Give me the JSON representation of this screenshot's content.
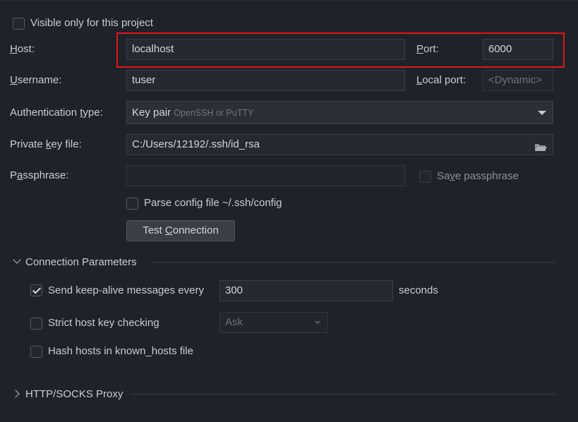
{
  "visible_only": {
    "label": "Visible only for this project",
    "checked": false
  },
  "host": {
    "label": "Host:",
    "mnemonic": "H",
    "rest": "ost:",
    "value": "localhost"
  },
  "port": {
    "label": "Port:",
    "mnemonic": "P",
    "rest": "ort:",
    "value": "6000"
  },
  "username": {
    "label": "Username:",
    "mnemonic": "U",
    "rest": "sername:",
    "value": "tuser"
  },
  "local_port": {
    "label": "Local port:",
    "mnemonic": "L",
    "rest": "ocal port:",
    "placeholder": "<Dynamic>"
  },
  "auth_type": {
    "label_pre": "Authentication ",
    "mnemonic": "t",
    "label_post": "ype:",
    "value": "Key pair",
    "hint": "OpenSSH or PuTTY"
  },
  "private_key": {
    "label_pre": "Private ",
    "mnemonic": "k",
    "label_post": "ey file:",
    "value": "C:/Users/12192/.ssh/id_rsa"
  },
  "passphrase": {
    "label_pre": "P",
    "mnemonic": "a",
    "label_post": "ssphrase:",
    "value": ""
  },
  "save_passphrase": {
    "label_pre": "Sa",
    "mnemonic": "v",
    "label_post": "e passphrase",
    "checked": false
  },
  "parse_config": {
    "label": "Parse config file ~/.ssh/config",
    "checked": false
  },
  "test_connection": {
    "label_pre": "Test ",
    "mnemonic": "C",
    "label_post": "onnection"
  },
  "connection_params": {
    "title": "Connection Parameters",
    "keepalive": {
      "label": "Send keep-alive messages every",
      "checked": true,
      "value": "300",
      "unit": "seconds"
    },
    "strict_host": {
      "label": "Strict host key checking",
      "checked": false,
      "option": "Ask"
    },
    "hash_hosts": {
      "label": "Hash hosts in known_hosts file",
      "checked": false
    }
  },
  "proxy": {
    "title": "HTTP/SOCKS Proxy"
  },
  "colors": {
    "highlight": "#e0161d",
    "background": "#1f2228"
  }
}
